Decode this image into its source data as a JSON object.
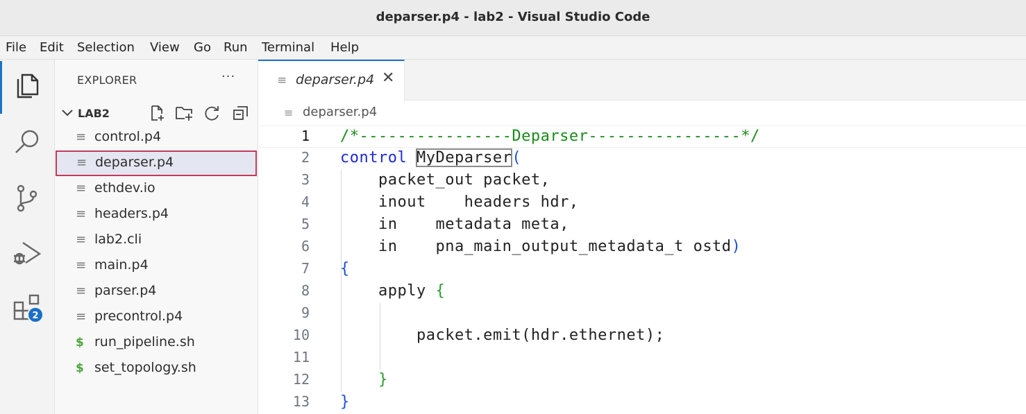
{
  "window": {
    "title": "deparser.p4 - lab2 - Visual Studio Code"
  },
  "menu": [
    "File",
    "Edit",
    "Selection",
    "View",
    "Go",
    "Run",
    "Terminal",
    "Help"
  ],
  "activity_bar": {
    "items": [
      "explorer-icon",
      "search-icon",
      "source-control-icon",
      "run-debug-icon",
      "extensions-icon"
    ],
    "extensions_badge": "2"
  },
  "explorer": {
    "title": "EXPLORER",
    "more": "···",
    "folder": "LAB2",
    "files": [
      {
        "name": "control.p4",
        "icon": "file-lines-icon"
      },
      {
        "name": "deparser.p4",
        "icon": "file-lines-icon",
        "selected": true
      },
      {
        "name": "ethdev.io",
        "icon": "file-lines-icon"
      },
      {
        "name": "headers.p4",
        "icon": "file-lines-icon"
      },
      {
        "name": "lab2.cli",
        "icon": "file-lines-icon"
      },
      {
        "name": "main.p4",
        "icon": "file-lines-icon"
      },
      {
        "name": "parser.p4",
        "icon": "file-lines-icon"
      },
      {
        "name": "precontrol.p4",
        "icon": "file-lines-icon"
      },
      {
        "name": "run_pipeline.sh",
        "icon": "shell-dollar-icon"
      },
      {
        "name": "set_topology.sh",
        "icon": "shell-dollar-icon"
      }
    ]
  },
  "tab": {
    "label": "deparser.p4",
    "close": "✕"
  },
  "breadcrumb": {
    "file": "deparser.p4"
  },
  "editor": {
    "line_numbers": [
      "1",
      "2",
      "3",
      "4",
      "5",
      "6",
      "7",
      "8",
      "9",
      "10",
      "11",
      "12",
      "13"
    ],
    "lines": {
      "l1": "/*----------------Deparser----------------*/",
      "l2_kw": "control",
      "l2_name": "MyDeparser",
      "l2_paren": "(",
      "l3": "    packet_out packet,",
      "l4": "    inout    headers hdr,",
      "l5": "    in    metadata meta,",
      "l6": "    in    pna_main_output_metadata_t ostd",
      "l6_paren": ")",
      "l7": "{",
      "l8": "    apply ",
      "l8_brace": "{",
      "l10": "        packet.emit(hdr.ethernet);",
      "l12": "    }",
      "l13": "}"
    }
  },
  "colors": {
    "accent": "#1a73c8",
    "selection_outline": "#c23b5a",
    "comment": "#1a8c1a",
    "keyword": "#1c2ad8"
  }
}
